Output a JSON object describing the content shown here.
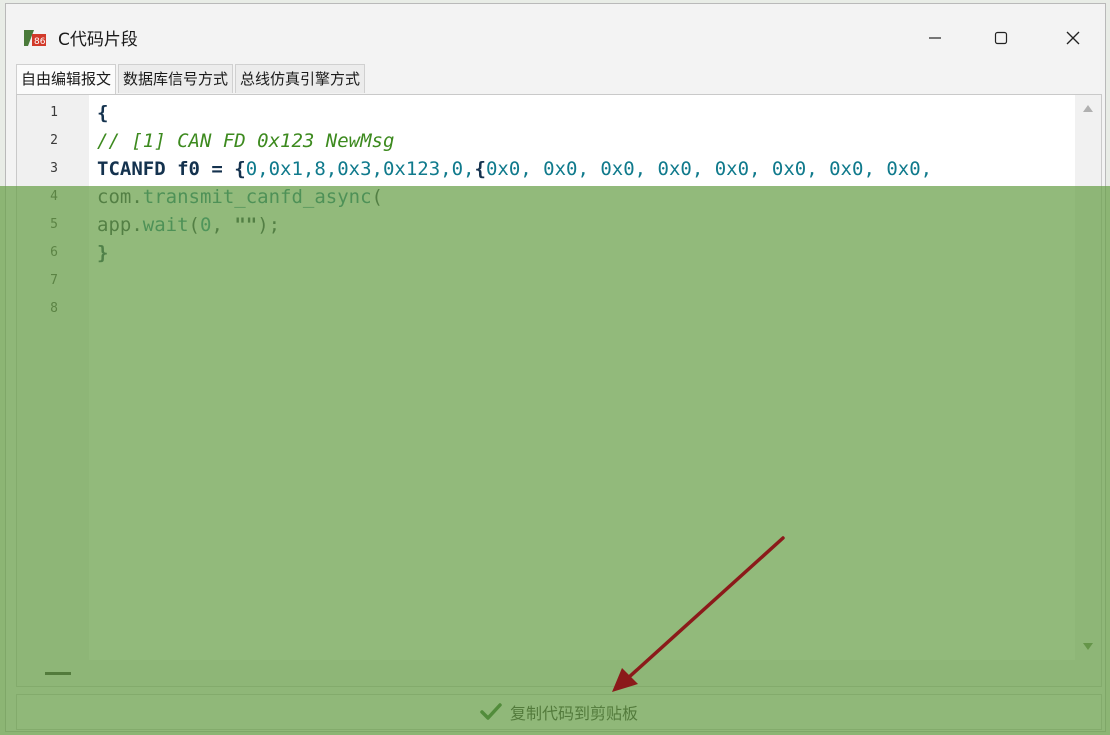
{
  "window": {
    "title": "C代码片段",
    "controls": {
      "minimize": "—",
      "maximize": "☐",
      "close": "✕"
    }
  },
  "tabs": [
    {
      "label": "自由编辑报文",
      "active": true
    },
    {
      "label": "数据库信号方式",
      "active": false
    },
    {
      "label": "总线仿真引擎方式",
      "active": false
    }
  ],
  "editor": {
    "line_numbers": [
      "1",
      "2",
      "3",
      "4",
      "5",
      "6",
      "7",
      "8"
    ],
    "lines": {
      "l1": "{",
      "l2": "// [1] CAN FD 0x123 NewMsg",
      "l3_kw": "TCANFD",
      "l3_var": " f0 = {",
      "l3_nums": "0,0x1,8,0x3,0x123,0,",
      "l3_brace": "{",
      "l3_data": "0x0, 0x0, 0x0, 0x0, 0x0, 0x0, 0x0, 0x0,",
      "l4_obj": "com.",
      "l4_fn": "transmit_canfd_async",
      "l4_rest": "(",
      "l5_obj": "app.",
      "l5_fn": "wait",
      "l5_args_open": "(",
      "l5_num": "0",
      "l5_sep": ", ",
      "l5_str": "\"\"",
      "l5_close": ");",
      "l6": "}"
    }
  },
  "copy_button": {
    "label": "复制代码到剪贴板",
    "icon": "check-icon"
  },
  "colors": {
    "overlay": "#68a048",
    "arrow": "#8b1a1a",
    "check": "#1a5a1a"
  }
}
